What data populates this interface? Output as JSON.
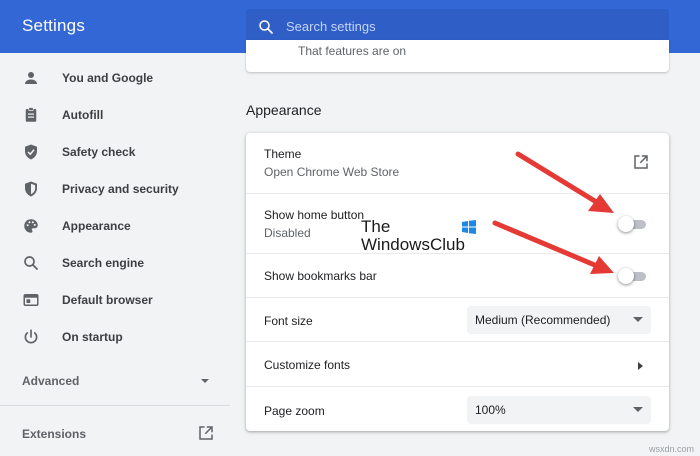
{
  "header": {
    "title": "Settings",
    "search_placeholder": "Search settings"
  },
  "sidebar": {
    "items": [
      {
        "label": "You and Google",
        "icon": "person-icon"
      },
      {
        "label": "Autofill",
        "icon": "clipboard-icon"
      },
      {
        "label": "Safety check",
        "icon": "shield-check-icon"
      },
      {
        "label": "Privacy and security",
        "icon": "shield-icon"
      },
      {
        "label": "Appearance",
        "icon": "palette-icon"
      },
      {
        "label": "Search engine",
        "icon": "search-icon"
      },
      {
        "label": "Default browser",
        "icon": "browser-icon"
      },
      {
        "label": "On startup",
        "icon": "power-icon"
      }
    ],
    "advanced_label": "Advanced",
    "extensions_label": "Extensions"
  },
  "main": {
    "partial_text": "That features are on",
    "section_title": "Appearance",
    "theme": {
      "title": "Theme",
      "subtitle": "Open Chrome Web Store"
    },
    "home_button": {
      "title": "Show home button",
      "subtitle": "Disabled",
      "enabled": false
    },
    "bookmarks_bar": {
      "title": "Show bookmarks bar",
      "enabled": false
    },
    "font_size": {
      "title": "Font size",
      "value": "Medium (Recommended)"
    },
    "customize_fonts": {
      "title": "Customize fonts"
    },
    "page_zoom": {
      "title": "Page zoom",
      "value": "100%"
    }
  },
  "watermark": {
    "line1": "The",
    "line2": "WindowsClub"
  },
  "footer": {
    "credit": "wsxdn.com"
  },
  "colors": {
    "header": "#3367d6",
    "search_box": "#2f5ec7",
    "background": "#f1f3f4",
    "card": "#ffffff",
    "toggle_track": "#bdc1c6",
    "arrow": "#e53935"
  }
}
